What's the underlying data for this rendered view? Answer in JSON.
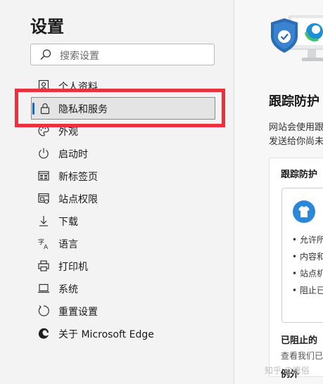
{
  "sidebar": {
    "title": "设置",
    "search_placeholder": "搜索设置",
    "items": [
      {
        "label": "个人资料",
        "icon": "profile-icon"
      },
      {
        "label": "隐私和服务",
        "icon": "lock-icon",
        "active": true
      },
      {
        "label": "外观",
        "icon": "palette-icon"
      },
      {
        "label": "启动时",
        "icon": "power-icon"
      },
      {
        "label": "新标签页",
        "icon": "new-tab-icon"
      },
      {
        "label": "站点权限",
        "icon": "site-permissions-icon"
      },
      {
        "label": "下载",
        "icon": "download-icon"
      },
      {
        "label": "语言",
        "icon": "language-icon"
      },
      {
        "label": "打印机",
        "icon": "printer-icon"
      },
      {
        "label": "系统",
        "icon": "system-icon"
      },
      {
        "label": "重置设置",
        "icon": "reset-icon"
      },
      {
        "label": "关于 Microsoft Edge",
        "icon": "edge-icon"
      }
    ]
  },
  "main": {
    "title": "跟踪防护",
    "desc_line1": "网站会使用跟",
    "desc_line2": "发送给你尚未",
    "card_title": "跟踪防护",
    "bullets": [
      "允许所",
      "内容和",
      "站点机",
      "阻止已"
    ],
    "blocked_title": "已阻止的",
    "blocked_sub": "查看我们已",
    "exceptions_title": "例外"
  },
  "watermark": "知乎 @庸俗",
  "colors": {
    "accent": "#0f6cbd",
    "highlight_box": "#e8323c"
  }
}
